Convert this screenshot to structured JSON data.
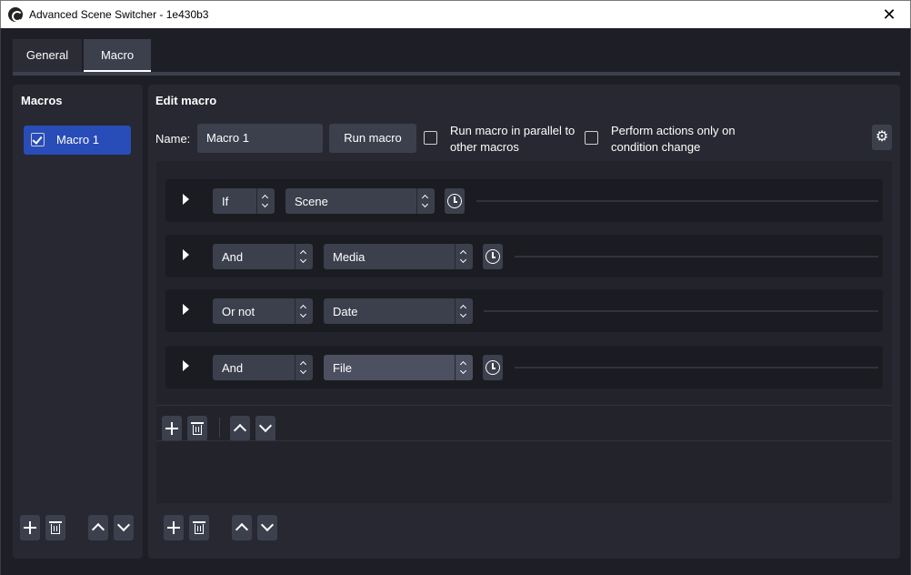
{
  "window": {
    "title": "Advanced Scene Switcher - 1e430b3",
    "close_glyph": "✕"
  },
  "tabs": [
    {
      "label": "General"
    },
    {
      "label": "Macro"
    }
  ],
  "macros_panel": {
    "title": "Macros",
    "items": [
      {
        "label": "Macro 1",
        "checked": true
      }
    ]
  },
  "edit_panel": {
    "title": "Edit macro",
    "name_label": "Name:",
    "name_value": "Macro 1",
    "run_button": "Run macro",
    "parallel_line1": "Run macro in parallel to",
    "parallel_line2": "other macros",
    "change_line1": "Perform actions only on",
    "change_line2": "condition change",
    "settings_icon": "gear-icon"
  },
  "conditions": [
    {
      "logic": "If",
      "type": "Scene",
      "has_clock": true
    },
    {
      "logic": "And",
      "type": "Media",
      "has_clock": true
    },
    {
      "logic": "Or not",
      "type": "Date",
      "has_clock": false
    },
    {
      "logic": "And",
      "type": "File",
      "has_clock": true
    }
  ],
  "icons": {
    "add": "plus-icon",
    "remove": "trash-icon",
    "up": "chevron-up-icon",
    "down": "chevron-down-icon",
    "clock": "clock-icon"
  },
  "colors": {
    "background": "#1e1f26",
    "panel": "#272831",
    "accent": "#284cb8",
    "control": "#3c404d"
  }
}
